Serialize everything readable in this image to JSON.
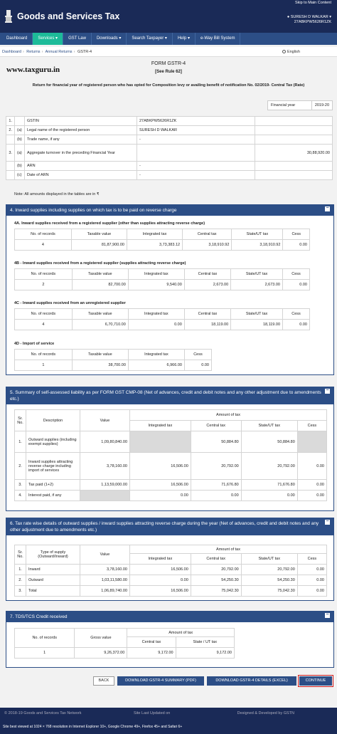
{
  "header": {
    "skip": "Skip to Main Content",
    "brand": "Goods and Services Tax",
    "user_name": "SURESH D WALKAR",
    "user_gstin": "27ABKPW5626R1ZK"
  },
  "nav": [
    "Dashboard",
    "Services",
    "GST Law",
    "Downloads",
    "Search Taxpayer",
    "Help",
    "e-Way Bill System"
  ],
  "breadcrumb": [
    "Dashboard",
    "Returns",
    "Annual Returns",
    "GSTR-4"
  ],
  "lang": "English",
  "watermark": "www.taxguru.in",
  "form": {
    "title": "FORM GSTR-4",
    "rule": "[See Rule 62]",
    "subtitle": "Return for financial year of registered person who has opted for Composition levy or availing benefit of notification No. 02/2019- Central Tax (Rate)",
    "fy_label": "Financial year",
    "fy_value": "2019-20"
  },
  "basic": [
    {
      "n": "1.",
      "s": "",
      "label": "GSTIN",
      "value": "27ABKPW5626R1ZK",
      "amount": ""
    },
    {
      "n": "2.",
      "s": "(a)",
      "label": "Legal name of the registered person",
      "value": "SURESH D WALKAR",
      "amount": ""
    },
    {
      "n": "",
      "s": "(b)",
      "label": "Trade name, if any",
      "value": "-",
      "amount": ""
    },
    {
      "n": "3.",
      "s": "(a)",
      "label": "Aggregate turnover in the preceding Financial Year",
      "value": "",
      "amount": "30,88,920.00"
    },
    {
      "n": "",
      "s": "(b)",
      "label": "ARN",
      "value": "-",
      "amount": ""
    },
    {
      "n": "",
      "s": "(c)",
      "label": "Date of ARN",
      "value": "-",
      "amount": ""
    }
  ],
  "note": "Note: All amounts displayed in the tables are in ₹",
  "s4": {
    "title": "4. Inward supplies including supplies on which tax is to be paid on reverse charge",
    "h": [
      "No. of records",
      "Taxable value",
      "Integrated tax",
      "Central tax",
      "State/UT tax",
      "Cess"
    ],
    "a": {
      "title": "4A. Inward supplies received from a registered supplier (other than supplies attracting reverse charge)",
      "row": [
        "4",
        "81,87,900.00",
        "3,73,383.12",
        "3,18,910.92",
        "3,18,910.92",
        "0.00"
      ]
    },
    "b": {
      "title": "4B - Inward supplies received from a registered supplier (supplies attracting reverse charge)",
      "row": [
        "2",
        "82,700.00",
        "9,540.00",
        "2,673.00",
        "2,673.00",
        "0.00"
      ]
    },
    "c": {
      "title": "4C - Inward supplies received from an unregistered supplier",
      "row": [
        "4",
        "6,70,710.00",
        "0.00",
        "18,119.00",
        "18,119.00",
        "0.00"
      ]
    },
    "d": {
      "title": "4D - Import of service",
      "h": [
        "No. of records",
        "Taxable value",
        "Integrated tax",
        "Cess"
      ],
      "row": [
        "1",
        "38,700.00",
        "6,966.00",
        "0.00"
      ]
    }
  },
  "s5": {
    "title": "5. Summary of self-assessed liability as per FORM GST CMP-08 (Net of advances, credit and debit notes and any other adjustment due to amendments etc.)",
    "h_sr": "Sr. No.",
    "h_desc": "Description",
    "h_val": "Value",
    "h_amt": "Amount of tax",
    "h_sub": [
      "Integrated tax",
      "Central tax",
      "State/UT tax",
      "Cess"
    ],
    "rows": [
      {
        "sr": "1.",
        "desc": "Outward supplies (including exempt supplies)",
        "val": "1,09,80,840.00",
        "it": "",
        "ct": "50,884.80",
        "st": "50,884.80",
        "cs": ""
      },
      {
        "sr": "2.",
        "desc": "Inward supplies attracting reverse charge including import of services",
        "val": "3,78,160.00",
        "it": "16,506.00",
        "ct": "20,792.00",
        "st": "20,792.00",
        "cs": "0.00"
      },
      {
        "sr": "3.",
        "desc": "Tax paid (1+2)",
        "val": "1,13,59,000.00",
        "it": "16,506.00",
        "ct": "71,676.80",
        "st": "71,676.80",
        "cs": "0.00"
      },
      {
        "sr": "4.",
        "desc": "Interest paid, if any",
        "val": "",
        "it": "0.00",
        "ct": "0.00",
        "st": "0.00",
        "cs": "0.00"
      }
    ]
  },
  "s6": {
    "title": "6. Tax rate wise details of outward supplies / inward supplies attracting reverse charge during the year (Net of advances, credit and debit notes and any other adjustment due to amendments etc.)",
    "h_sr": "Sr. No.",
    "h_type": "Type of supply (Outward/Inward)",
    "h_val": "Value",
    "h_amt": "Amount of tax",
    "h_sub": [
      "Integrated tax",
      "Central tax",
      "State/UT tax",
      "Cess"
    ],
    "rows": [
      {
        "sr": "1.",
        "type": "Inward",
        "val": "3,78,160.00",
        "it": "16,506.00",
        "ct": "20,792.00",
        "st": "20,792.00",
        "cs": "0.00"
      },
      {
        "sr": "2.",
        "type": "Outward",
        "val": "1,03,11,580.00",
        "it": "0.00",
        "ct": "54,250.30",
        "st": "54,250.30",
        "cs": "0.00"
      },
      {
        "sr": "3.",
        "type": "Total",
        "val": "1,06,89,740.00",
        "it": "16,506.00",
        "ct": "75,042.30",
        "st": "75,042.30",
        "cs": "0.00"
      }
    ]
  },
  "s7": {
    "title": "7. TDS/TCS Credit received",
    "h_rec": "No. of records",
    "h_gross": "Gross value",
    "h_amt": "Amount of tax",
    "h_sub": [
      "Central tax",
      "State / UT tax"
    ],
    "row": [
      "1",
      "9,26,372.00",
      "9,172.00",
      "9,172.00"
    ]
  },
  "buttons": {
    "back": "BACK",
    "pdf": "DOWNLOAD GSTR-4 SUMMARY (PDF)",
    "excel": "DOWNLOAD GSTR-4 DETAILS (EXCEL)",
    "cont": "CONTINUE"
  },
  "footer": {
    "copy": "© 2018-19 Goods and Services Tax Network",
    "updated": "Site Last Updated on",
    "designed": "Designed & Developed by GSTN",
    "browser": "Site best viewed at 1024 × 768 resolution in Internet Explorer 10+, Google Chrome 49+, Firefox 45+ and Safari 6+"
  }
}
